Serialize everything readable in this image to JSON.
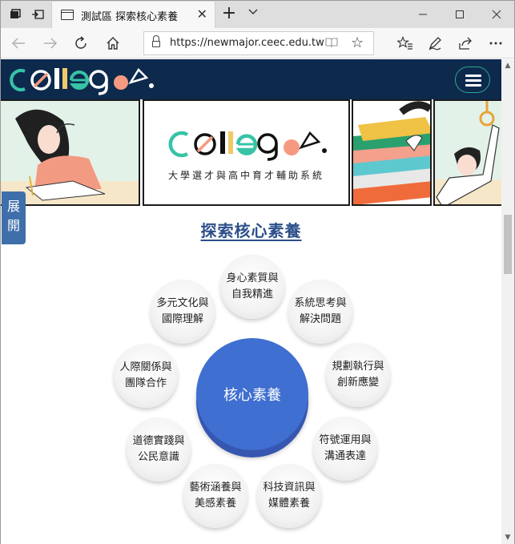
{
  "browser": {
    "tab_title": "測試區 探索核心素養",
    "url": "https://newmajor.ceec.edu.tw"
  },
  "site": {
    "logo_text": "college",
    "tagline": "大學選才與高中育才輔助系統"
  },
  "side_tab": {
    "label_line1": "展",
    "label_line2": "開"
  },
  "section": {
    "title": "探索核心素養",
    "center_label": "核心素養",
    "competencies": [
      {
        "line1": "身心素質與",
        "line2": "自我精進"
      },
      {
        "line1": "系統思考與",
        "line2": "解決問題"
      },
      {
        "line1": "規劃執行與",
        "line2": "創新應變"
      },
      {
        "line1": "符號運用與",
        "line2": "溝通表達"
      },
      {
        "line1": "科技資訊與",
        "line2": "媒體素養"
      },
      {
        "line1": "藝術涵養與",
        "line2": "美感素養"
      },
      {
        "line1": "道德實踐與",
        "line2": "公民意識"
      },
      {
        "line1": "人際關係與",
        "line2": "團隊合作"
      },
      {
        "line1": "多元文化與",
        "line2": "國際理解"
      }
    ]
  },
  "colors": {
    "header_bg": "#0d2a4d",
    "accent_teal": "#2fa88f",
    "center_blue": "#3f6fd0",
    "title_blue": "#2c4f8a"
  }
}
